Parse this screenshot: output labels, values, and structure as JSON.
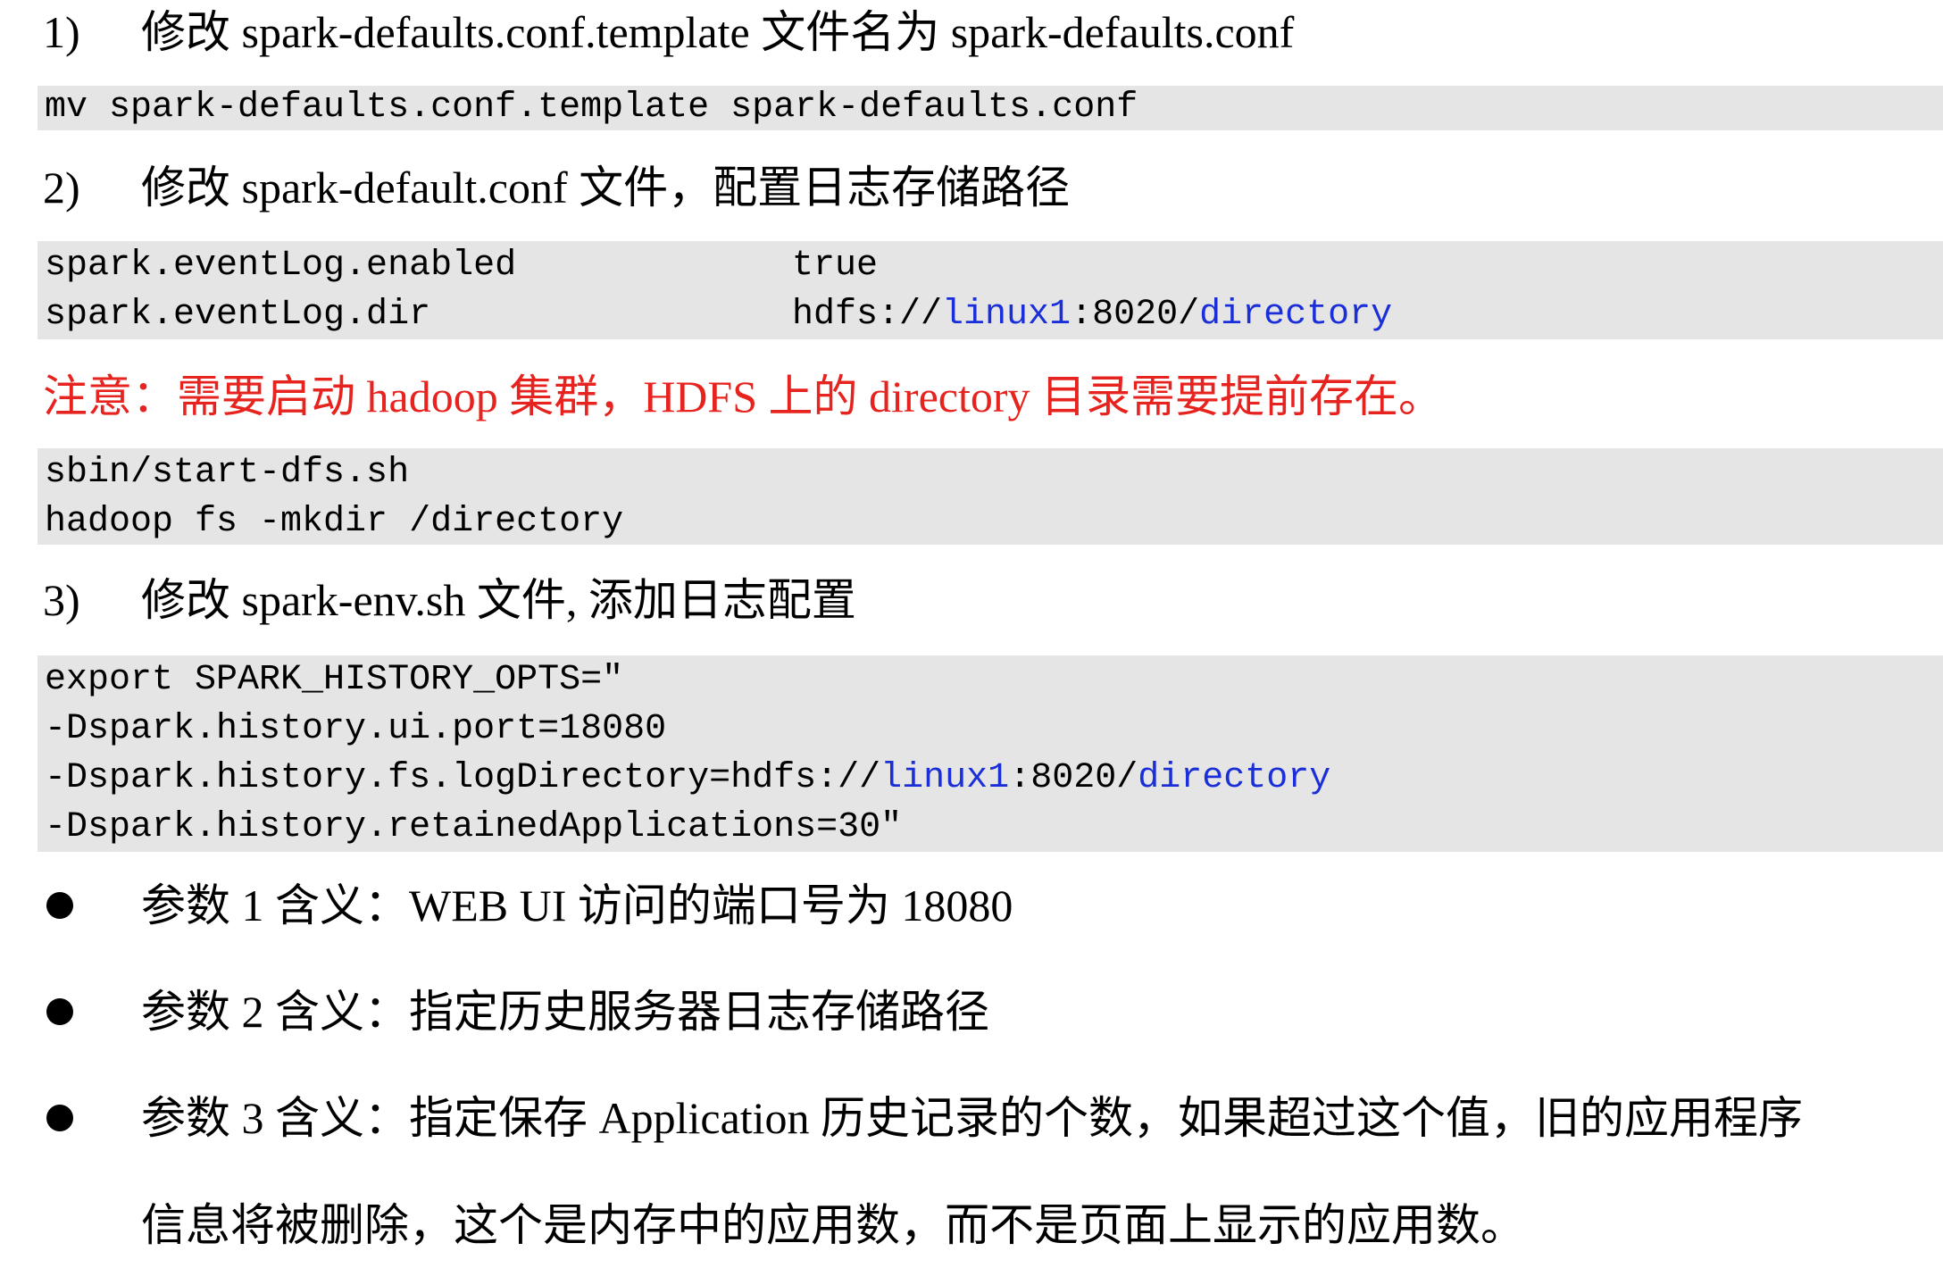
{
  "steps": [
    {
      "num": "1)",
      "text": "修改 spark-defaults.conf.template 文件名为 spark-defaults.conf"
    },
    {
      "num": "2)",
      "text": "修改 spark-default.conf 文件，配置日志存储路径"
    },
    {
      "num": "3)",
      "text": "修改 spark-env.sh 文件, 添加日志配置"
    }
  ],
  "code1": "mv spark-defaults.conf.template spark-defaults.conf",
  "code2": {
    "line1_key": "spark.eventLog.enabled",
    "line1_val": "true",
    "line2_key": "spark.eventLog.dir",
    "line2_pre": "hdfs://",
    "line2_host": "linux1",
    "line2_mid": ":8020/",
    "line2_path": "directory"
  },
  "note": "注意：需要启动 hadoop 集群，HDFS 上的 directory 目录需要提前存在。",
  "code3": [
    "sbin/start-dfs.sh",
    "hadoop fs -mkdir /directory"
  ],
  "code4": {
    "line1": "export SPARK_HISTORY_OPTS=\"",
    "line2": "-Dspark.history.ui.port=18080",
    "line3_pre": "-Dspark.history.fs.logDirectory=hdfs://",
    "line3_host": "linux1",
    "line3_mid": ":8020/",
    "line3_path": "directory",
    "line4": "-Dspark.history.retainedApplications=30\""
  },
  "bullets": [
    "参数 1 含义：WEB UI 访问的端口号为 18080",
    "参数 2 含义：指定历史服务器日志存储路径",
    "参数 3 含义：指定保存 Application 历史记录的个数，如果超过这个值，旧的应用程序"
  ],
  "bullet3_cont": "信息将被删除，这个是内存中的应用数，而不是页面上显示的应用数。",
  "colors": {
    "code_bg": "#e5e5e5",
    "link_blue": "#1a2fd8",
    "note_red": "#e6231e"
  }
}
